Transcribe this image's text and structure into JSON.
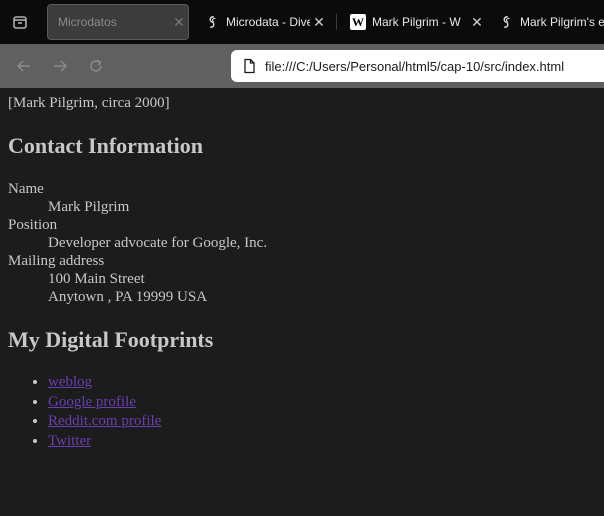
{
  "tabs": [
    {
      "title": "Microdatos",
      "active": true,
      "icon": "none"
    },
    {
      "title": "Microdata - Dive",
      "active": false,
      "icon": "dive-into-icon"
    },
    {
      "title": "Mark Pilgrim - W",
      "active": false,
      "icon": "wikipedia-icon"
    },
    {
      "title": "Mark Pilgrim's e",
      "active": false,
      "icon": "dive-into-icon"
    }
  ],
  "tab_close_glyph": "✕",
  "wikipedia_letter": "W",
  "toolbar": {
    "url": "file:///C:/Users/Personal/html5/cap-10/src/index.html"
  },
  "page": {
    "photo_alt": "[Mark Pilgrim, circa 2000]",
    "contact_heading": "Contact Information",
    "contact": {
      "name_label": "Name",
      "name_value": "Mark Pilgrim",
      "position_label": "Position",
      "position_value": "Developer advocate for Google, Inc.",
      "address_label": "Mailing address",
      "street": "100 Main Street",
      "city_line": "Anytown , PA 19999 USA"
    },
    "footprints_heading": "My Digital Footprints",
    "links": [
      "weblog",
      "Google profile",
      "Reddit.com profile",
      "Twitter"
    ]
  },
  "colors": {
    "page_bg": "#1c1c1c",
    "text": "#c8c8c8",
    "link": "#6a3fb0",
    "tabstrip_bg": "#0b0b0b",
    "toolbar_bg": "#606060"
  }
}
